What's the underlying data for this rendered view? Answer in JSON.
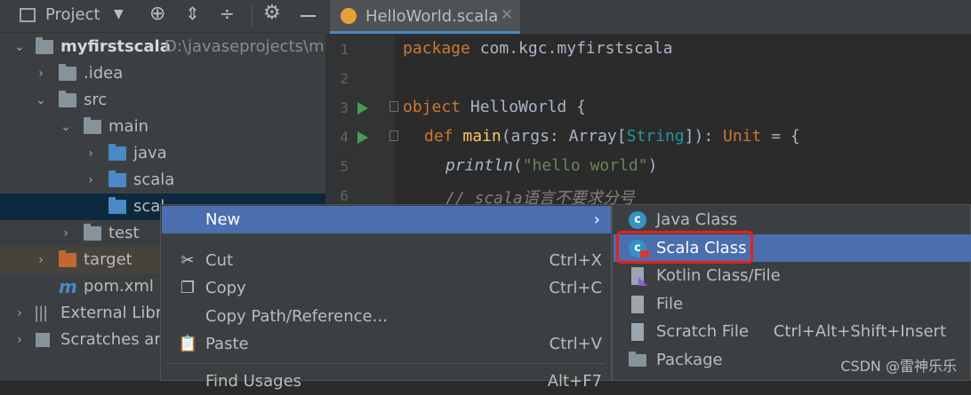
{
  "panel": {
    "title": "Project",
    "tree": [
      {
        "label": "myfirstscala",
        "path": "D:\\javaseprojects\\my"
      },
      {
        "label": ".idea"
      },
      {
        "label": "src"
      },
      {
        "label": "main"
      },
      {
        "label": "java"
      },
      {
        "label": "scala"
      },
      {
        "label": "scal"
      },
      {
        "label": "test"
      },
      {
        "label": "target"
      },
      {
        "label": "pom.xml"
      },
      {
        "label": "External Libra"
      },
      {
        "label": "Scratches and"
      }
    ]
  },
  "editor": {
    "tab_title": "HelloWorld.scala",
    "lines": [
      "1",
      "2",
      "3",
      "4",
      "5",
      "6"
    ],
    "code": {
      "l1_kw": "package",
      "l1_rest": " com.kgc.myfirstscala",
      "l3_kw": "object",
      "l3_rest": " HelloWorld {",
      "l4_kw": "def",
      "l4_fn": "main",
      "l4_a": "(args: Array[",
      "l4_type": "String",
      "l4_b": "]): ",
      "l4_unit": "Unit",
      "l4_c": " = {",
      "l5_fn": "println",
      "l5_a": "(",
      "l5_str": "\"hello world\"",
      "l5_b": ")",
      "l6_cmt": "// scala语言不要求分号"
    }
  },
  "context_menu": {
    "items": [
      {
        "label": "New",
        "shortcut": "",
        "icon": "submenu-arrow"
      },
      {
        "label": "Cut",
        "shortcut": "Ctrl+X",
        "icon": "scissors-icon"
      },
      {
        "label": "Copy",
        "shortcut": "Ctrl+C",
        "icon": "copy-icon"
      },
      {
        "label": "Copy Path/Reference...",
        "shortcut": "",
        "icon": ""
      },
      {
        "label": "Paste",
        "shortcut": "Ctrl+V",
        "icon": "clipboard-icon"
      },
      {
        "label": "Find Usages",
        "shortcut": "Alt+F7",
        "icon": ""
      }
    ]
  },
  "submenu": {
    "items": [
      {
        "label": "Java Class",
        "shortcut": ""
      },
      {
        "label": "Scala Class",
        "shortcut": ""
      },
      {
        "label": "Kotlin Class/File",
        "shortcut": ""
      },
      {
        "label": "File",
        "shortcut": ""
      },
      {
        "label": "Scratch File",
        "shortcut": "Ctrl+Alt+Shift+Insert"
      },
      {
        "label": "Package",
        "shortcut": ""
      }
    ]
  },
  "watermark": "CSDN @雷神乐乐",
  "colors": {
    "accent": "#4b6eaf",
    "highlight_border": "#e5211b"
  }
}
